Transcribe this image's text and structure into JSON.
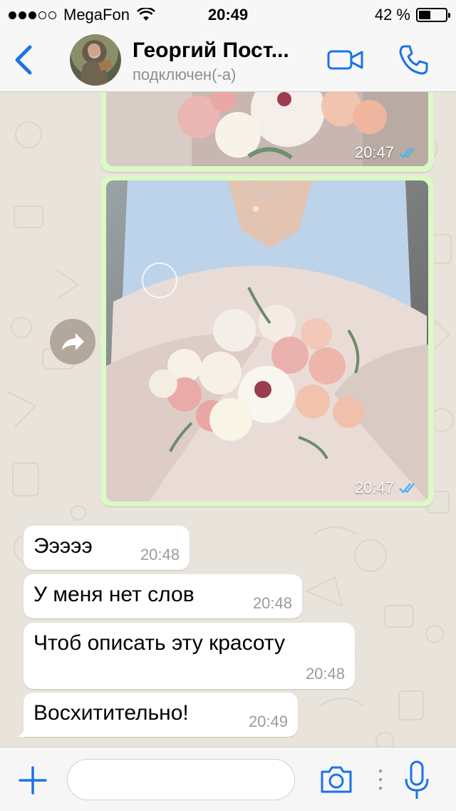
{
  "status_bar": {
    "carrier": "MegaFon",
    "time": "20:49",
    "battery_percent": "42 %",
    "signal_bars_filled": 3,
    "signal_bars_total": 5,
    "battery_level": 0.42
  },
  "header": {
    "contact_name": "Георгий Пост...",
    "contact_status": "подключен(-а)",
    "accent_color": "#1a73e8"
  },
  "messages": [
    {
      "type": "image",
      "direction": "outgoing",
      "time": "20:47",
      "status": "read"
    },
    {
      "type": "image",
      "direction": "outgoing",
      "time": "20:47",
      "status": "read"
    },
    {
      "type": "text",
      "direction": "incoming",
      "text": "Эээээ",
      "time": "20:48"
    },
    {
      "type": "text",
      "direction": "incoming",
      "text": "У меня нет слов",
      "time": "20:48"
    },
    {
      "type": "text",
      "direction": "incoming",
      "text": "Чтоб описать эту красоту",
      "time": "20:48"
    },
    {
      "type": "text",
      "direction": "incoming",
      "text": "Восхитительно!",
      "time": "20:49"
    }
  ],
  "input_bar": {
    "placeholder": "",
    "value": ""
  },
  "icons": {
    "back": "chevron-left-icon",
    "video": "video-camera-icon",
    "call": "phone-icon",
    "forward": "forward-arrow-icon",
    "attach": "plus-icon",
    "camera": "camera-icon",
    "mic": "microphone-icon",
    "read": "double-check-icon"
  },
  "colors": {
    "outgoing_bubble": "#dcf8c6",
    "incoming_bubble": "#ffffff",
    "read_ticks": "#4fb6ec",
    "icon_blue": "#1a73e8"
  }
}
